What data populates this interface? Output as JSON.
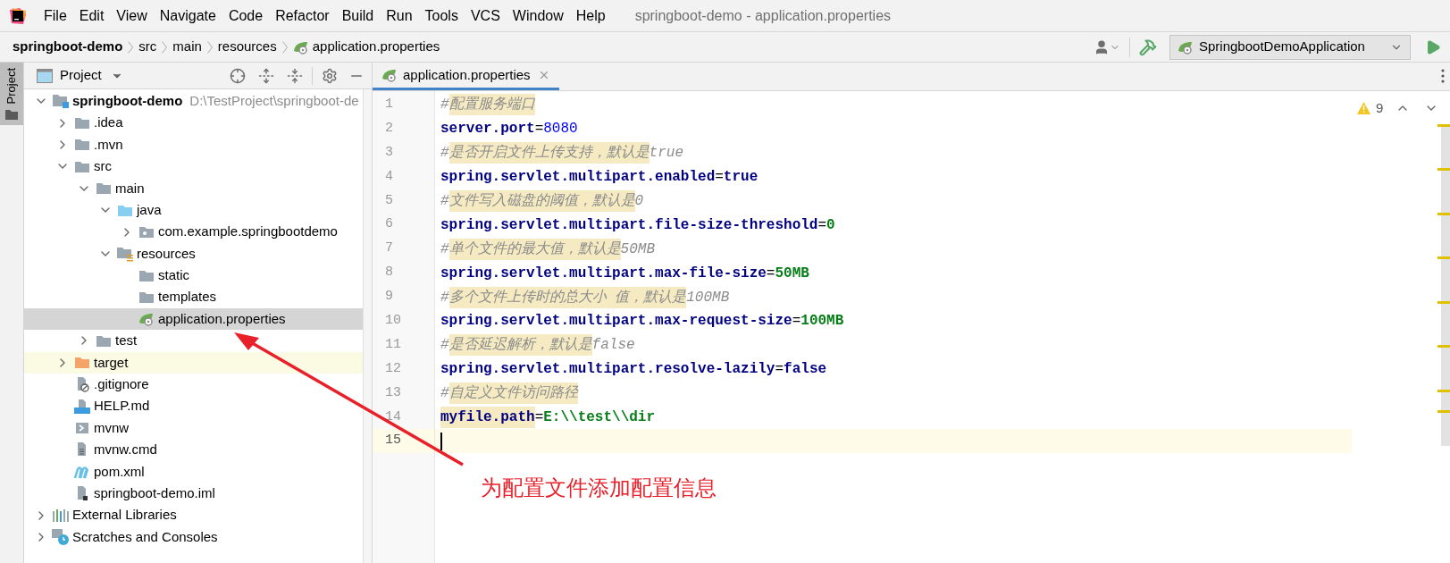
{
  "menu": [
    "File",
    "Edit",
    "View",
    "Navigate",
    "Code",
    "Refactor",
    "Build",
    "Run",
    "Tools",
    "VCS",
    "Window",
    "Help"
  ],
  "window_title": "springboot-demo - application.properties",
  "breadcrumbs": [
    {
      "label": "springboot-demo",
      "kind": "project"
    },
    {
      "label": "src",
      "kind": "folder"
    },
    {
      "label": "main",
      "kind": "folder"
    },
    {
      "label": "resources",
      "kind": "folder"
    },
    {
      "label": "application.properties",
      "kind": "properties"
    }
  ],
  "run_config": "SpringbootDemoApplication",
  "side_tab": "Project",
  "project_panel": {
    "title": "Project",
    "tree": [
      {
        "label": "springboot-demo",
        "detail": "D:\\TestProject\\springboot-de",
        "kind": "module",
        "expanded": true,
        "selected": false,
        "children": [
          {
            "label": ".idea",
            "kind": "folder",
            "expanded": false,
            "selected": false
          },
          {
            "label": ".mvn",
            "kind": "folder",
            "expanded": false,
            "selected": false
          },
          {
            "label": "src",
            "kind": "folder",
            "expanded": true,
            "selected": false,
            "children": [
              {
                "label": "main",
                "kind": "folder",
                "expanded": true,
                "selected": false,
                "children": [
                  {
                    "label": "java",
                    "kind": "source-folder",
                    "expanded": true,
                    "selected": false,
                    "children": [
                      {
                        "label": "com.example.springbootdemo",
                        "kind": "package",
                        "expanded": false,
                        "selected": false
                      }
                    ]
                  },
                  {
                    "label": "resources",
                    "kind": "resources-folder",
                    "expanded": true,
                    "selected": false,
                    "children": [
                      {
                        "label": "static",
                        "kind": "plain-folder",
                        "selected": false
                      },
                      {
                        "label": "templates",
                        "kind": "plain-folder",
                        "selected": false
                      },
                      {
                        "label": "application.properties",
                        "kind": "properties",
                        "selected": true
                      }
                    ]
                  }
                ]
              },
              {
                "label": "test",
                "kind": "folder",
                "expanded": false,
                "selected": false
              }
            ]
          },
          {
            "label": "target",
            "kind": "excluded-folder",
            "expanded": false,
            "selected": false
          },
          {
            "label": ".gitignore",
            "kind": "gitignore",
            "selected": false
          },
          {
            "label": "HELP.md",
            "kind": "markdown",
            "selected": false
          },
          {
            "label": "mvnw",
            "kind": "shell",
            "selected": false
          },
          {
            "label": "mvnw.cmd",
            "kind": "script",
            "selected": false
          },
          {
            "label": "pom.xml",
            "kind": "maven",
            "selected": false
          },
          {
            "label": "springboot-demo.iml",
            "kind": "iml",
            "selected": false
          }
        ]
      },
      {
        "label": "External Libraries",
        "kind": "libraries",
        "expanded": false,
        "selected": false
      },
      {
        "label": "Scratches and Consoles",
        "kind": "scratches",
        "expanded": false,
        "selected": false
      }
    ]
  },
  "editor": {
    "tabs": [
      {
        "label": "application.properties",
        "selected": true
      }
    ],
    "warnings": "9",
    "lines": [
      {
        "number": "1",
        "current": false,
        "segments": [
          {
            "text": "#",
            "kind": "comment",
            "highlight": false
          },
          {
            "text": "配置服务端口",
            "kind": "comment",
            "highlight": true
          }
        ]
      },
      {
        "number": "2",
        "current": false,
        "segments": [
          {
            "text": "server.port",
            "kind": "key",
            "highlight": false
          },
          {
            "text": "=",
            "kind": "sign",
            "highlight": false
          },
          {
            "text": "8080",
            "kind": "number",
            "highlight": false
          }
        ]
      },
      {
        "number": "3",
        "current": false,
        "segments": [
          {
            "text": "#",
            "kind": "comment",
            "highlight": false
          },
          {
            "text": "是否开启文件上传支持，默认是",
            "kind": "comment",
            "highlight": true
          },
          {
            "text": "true",
            "kind": "comment",
            "highlight": false
          }
        ]
      },
      {
        "number": "4",
        "current": false,
        "segments": [
          {
            "text": "spring.servlet.multipart.enabled",
            "kind": "key",
            "highlight": false
          },
          {
            "text": "=",
            "kind": "sign",
            "highlight": false
          },
          {
            "text": "true",
            "kind": "keyword",
            "highlight": false
          }
        ]
      },
      {
        "number": "5",
        "current": false,
        "segments": [
          {
            "text": "#",
            "kind": "comment",
            "highlight": false
          },
          {
            "text": "文件写入磁盘的阈值，默认是",
            "kind": "comment",
            "highlight": true
          },
          {
            "text": "0",
            "kind": "comment",
            "highlight": false
          }
        ]
      },
      {
        "number": "6",
        "current": false,
        "segments": [
          {
            "text": "spring.servlet.multipart.file-size-threshold",
            "kind": "key",
            "highlight": false
          },
          {
            "text": "=",
            "kind": "sign",
            "highlight": false
          },
          {
            "text": "0",
            "kind": "value",
            "highlight": false
          }
        ]
      },
      {
        "number": "7",
        "current": false,
        "segments": [
          {
            "text": "#",
            "kind": "comment",
            "highlight": false
          },
          {
            "text": "单个文件的最大值，默认是",
            "kind": "comment",
            "highlight": true
          },
          {
            "text": "50MB",
            "kind": "comment",
            "highlight": false
          }
        ]
      },
      {
        "number": "8",
        "current": false,
        "segments": [
          {
            "text": "spring.servlet.multipart.max-file-size",
            "kind": "key",
            "highlight": false
          },
          {
            "text": "=",
            "kind": "sign",
            "highlight": false
          },
          {
            "text": "50MB",
            "kind": "value",
            "highlight": false
          }
        ]
      },
      {
        "number": "9",
        "current": false,
        "segments": [
          {
            "text": "#",
            "kind": "comment",
            "highlight": false
          },
          {
            "text": "多个文件上传时的总大小",
            "kind": "comment",
            "highlight": true
          },
          {
            "text": " 值，默认是",
            "kind": "comment",
            "highlight": true
          },
          {
            "text": "100MB",
            "kind": "comment",
            "highlight": false
          }
        ]
      },
      {
        "number": "10",
        "current": false,
        "segments": [
          {
            "text": "spring.servlet.multipart.max-request-size",
            "kind": "key",
            "highlight": false
          },
          {
            "text": "=",
            "kind": "sign",
            "highlight": false
          },
          {
            "text": "100MB",
            "kind": "value",
            "highlight": false
          }
        ]
      },
      {
        "number": "11",
        "current": false,
        "segments": [
          {
            "text": "#",
            "kind": "comment",
            "highlight": false
          },
          {
            "text": "是否延迟解析，默认是",
            "kind": "comment",
            "highlight": true
          },
          {
            "text": "false",
            "kind": "comment",
            "highlight": false
          }
        ]
      },
      {
        "number": "12",
        "current": false,
        "segments": [
          {
            "text": "spring.servlet.multipart.resolve-lazily",
            "kind": "key",
            "highlight": false
          },
          {
            "text": "=",
            "kind": "sign",
            "highlight": false
          },
          {
            "text": "false",
            "kind": "keyword",
            "highlight": false
          }
        ]
      },
      {
        "number": "13",
        "current": false,
        "segments": [
          {
            "text": "#",
            "kind": "comment",
            "highlight": false
          },
          {
            "text": "自定义文件访问路径",
            "kind": "comment",
            "highlight": true
          }
        ]
      },
      {
        "number": "14",
        "current": false,
        "segments": [
          {
            "text": "myfile.path",
            "kind": "key",
            "highlight": true
          },
          {
            "text": "=",
            "kind": "sign",
            "highlight": false
          },
          {
            "text": "E:\\\\test\\\\dir",
            "kind": "value",
            "highlight": false
          }
        ]
      },
      {
        "number": "15",
        "current": true
      }
    ]
  },
  "annotation": {
    "text": "为配置文件添加配置信息"
  }
}
